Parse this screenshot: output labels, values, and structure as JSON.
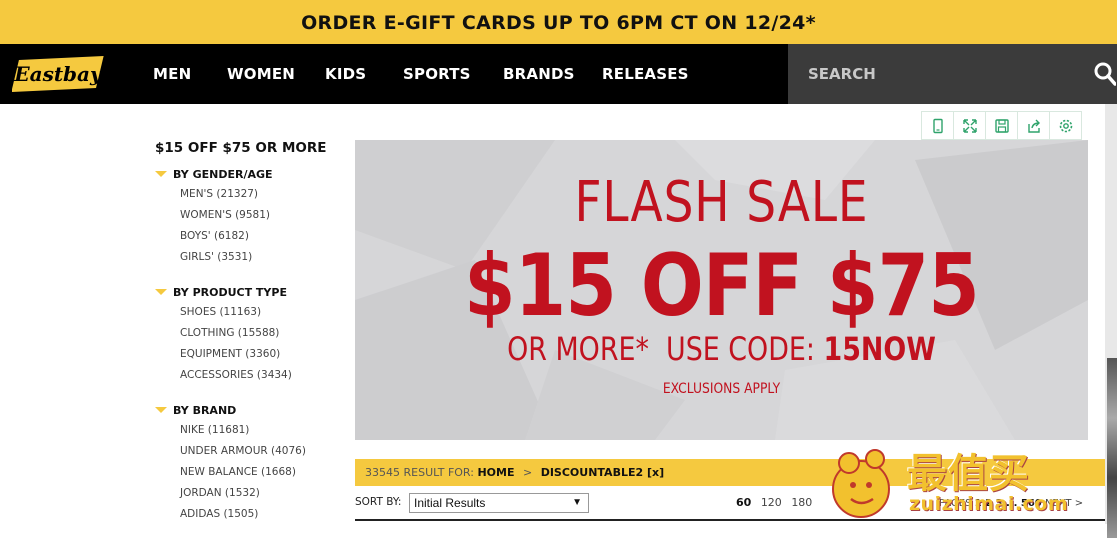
{
  "promo": {
    "text": "ORDER E-GIFT CARDS UP TO 6PM CT ON 12/24*"
  },
  "header": {
    "logo_text": "Eastbay",
    "nav": [
      "MEN",
      "WOMEN",
      "KIDS",
      "SPORTS",
      "BRANDS",
      "RELEASES"
    ],
    "search_placeholder": "SEARCH"
  },
  "toolbar": {
    "icons": [
      "mobile-icon",
      "fullscreen-icon",
      "save-icon",
      "share-icon",
      "settings-icon"
    ]
  },
  "sidebar": {
    "title": "$15 OFF $75 OR MORE",
    "groups": [
      {
        "heading": "BY GENDER/AGE",
        "items": [
          "MEN'S (21327)",
          "WOMEN'S (9581)",
          "BOYS' (6182)",
          "GIRLS' (3531)"
        ]
      },
      {
        "heading": "BY PRODUCT TYPE",
        "items": [
          "SHOES (11163)",
          "CLOTHING (15588)",
          "EQUIPMENT (3360)",
          "ACCESSORIES (3434)"
        ]
      },
      {
        "heading": "BY BRAND",
        "items": [
          "NIKE (11681)",
          "UNDER ARMOUR (4076)",
          "NEW BALANCE (1668)",
          "JORDAN (1532)",
          "ADIDAS (1505)"
        ]
      }
    ]
  },
  "hero": {
    "line1": "FLASH SALE",
    "line2": "$15 OFF $75",
    "line3_prefix": "OR MORE*  USE CODE: ",
    "line3_code": "15NOW",
    "line4": "EXCLUSIONS APPLY"
  },
  "results": {
    "count_text": "33545 RESULT FOR:",
    "crumb_home": "HOME",
    "crumb_sep": ">",
    "crumb_current": "DISCOUNTABLE2 [x]"
  },
  "sort": {
    "label": "SORT BY:",
    "selected": "Initial Results",
    "per_page": [
      "60",
      "120",
      "180"
    ],
    "pages_label": "PAGES",
    "pages_text": "1 2 3 ... 560",
    "next": "NEXT >"
  },
  "watermark": {
    "title": "最值买",
    "url": "zuizhimai.com"
  },
  "colors": {
    "accent_yellow": "#f5c93f",
    "sale_red": "#c1121f",
    "nav_black": "#000000"
  }
}
